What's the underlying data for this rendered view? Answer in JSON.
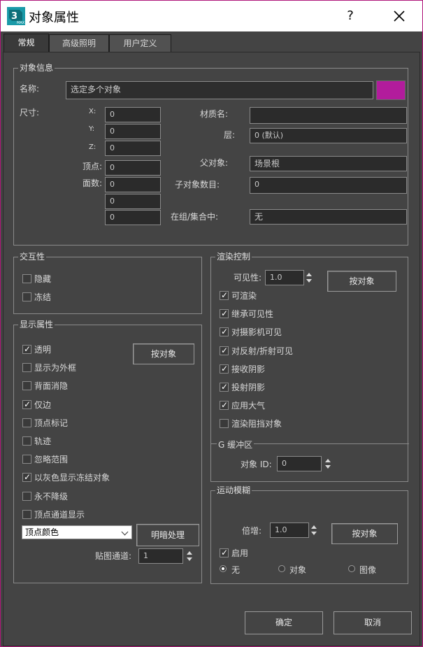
{
  "window": {
    "title": "对象属性",
    "help": "?"
  },
  "tabs": [
    "常规",
    "高级照明",
    "用户定义"
  ],
  "object_info": {
    "title": "对象信息",
    "name_label": "名称:",
    "name_value": "选定多个对象",
    "color": "#b21c9c",
    "dims_label": "尺寸:",
    "x_label": "X:",
    "x_value": "0",
    "y_label": "Y:",
    "y_value": "0",
    "z_label": "Z:",
    "z_value": "0",
    "vertices_label": "顶点:",
    "vertices_value": "0",
    "faces_label": "面数:",
    "faces_value": "0",
    "extra1_value": "0",
    "extra2_value": "0",
    "material_label": "材质名:",
    "material_value": "",
    "layer_label": "层:",
    "layer_value": "0 (默认)",
    "parent_label": "父对象:",
    "parent_value": "场景根",
    "children_label": "子对象数目:",
    "children_value": "0",
    "group_label": "在组/集合中:",
    "group_value": "无"
  },
  "interactivity": {
    "title": "交互性",
    "hide": "隐藏",
    "freeze": "冻结"
  },
  "display": {
    "title": "显示属性",
    "by_object": "按对象",
    "items": [
      {
        "label": "透明",
        "checked": true
      },
      {
        "label": "显示为外框",
        "checked": false
      },
      {
        "label": "背面消隐",
        "checked": false
      },
      {
        "label": "仅边",
        "checked": true
      },
      {
        "label": "顶点标记",
        "checked": false
      },
      {
        "label": "轨迹",
        "checked": false
      },
      {
        "label": "忽略范围",
        "checked": false
      },
      {
        "label": "以灰色显示冻结对象",
        "checked": true
      },
      {
        "label": "永不降级",
        "checked": false
      },
      {
        "label": "顶点通道显示",
        "checked": false
      }
    ],
    "vertex_color_select": "顶点颜色",
    "shaded_button": "明暗处理",
    "map_channel_label": "贴图通道:",
    "map_channel_value": "1"
  },
  "render": {
    "title": "渲染控制",
    "visibility_label": "可见性:",
    "visibility_value": "1.0",
    "by_object": "按对象",
    "items": [
      {
        "label": "可渲染",
        "checked": true
      },
      {
        "label": "继承可见性",
        "checked": true
      },
      {
        "label": "对摄影机可见",
        "checked": true
      },
      {
        "label": "对反射/折射可见",
        "checked": true
      },
      {
        "label": "接收阴影",
        "checked": true
      },
      {
        "label": "投射阴影",
        "checked": true
      },
      {
        "label": "应用大气",
        "checked": true
      },
      {
        "label": "渲染阻挡对象",
        "checked": false
      }
    ],
    "gbuffer_title": "G 缓冲区",
    "object_id_label": "对象 ID:",
    "object_id_value": "0"
  },
  "motion_blur": {
    "title": "运动模糊",
    "multiplier_label": "倍增:",
    "multiplier_value": "1.0",
    "by_object": "按对象",
    "enabled_label": "启用",
    "enabled": true,
    "radio_none": "无",
    "radio_object": "对象",
    "radio_image": "图像"
  },
  "buttons": {
    "ok": "确定",
    "cancel": "取消"
  }
}
